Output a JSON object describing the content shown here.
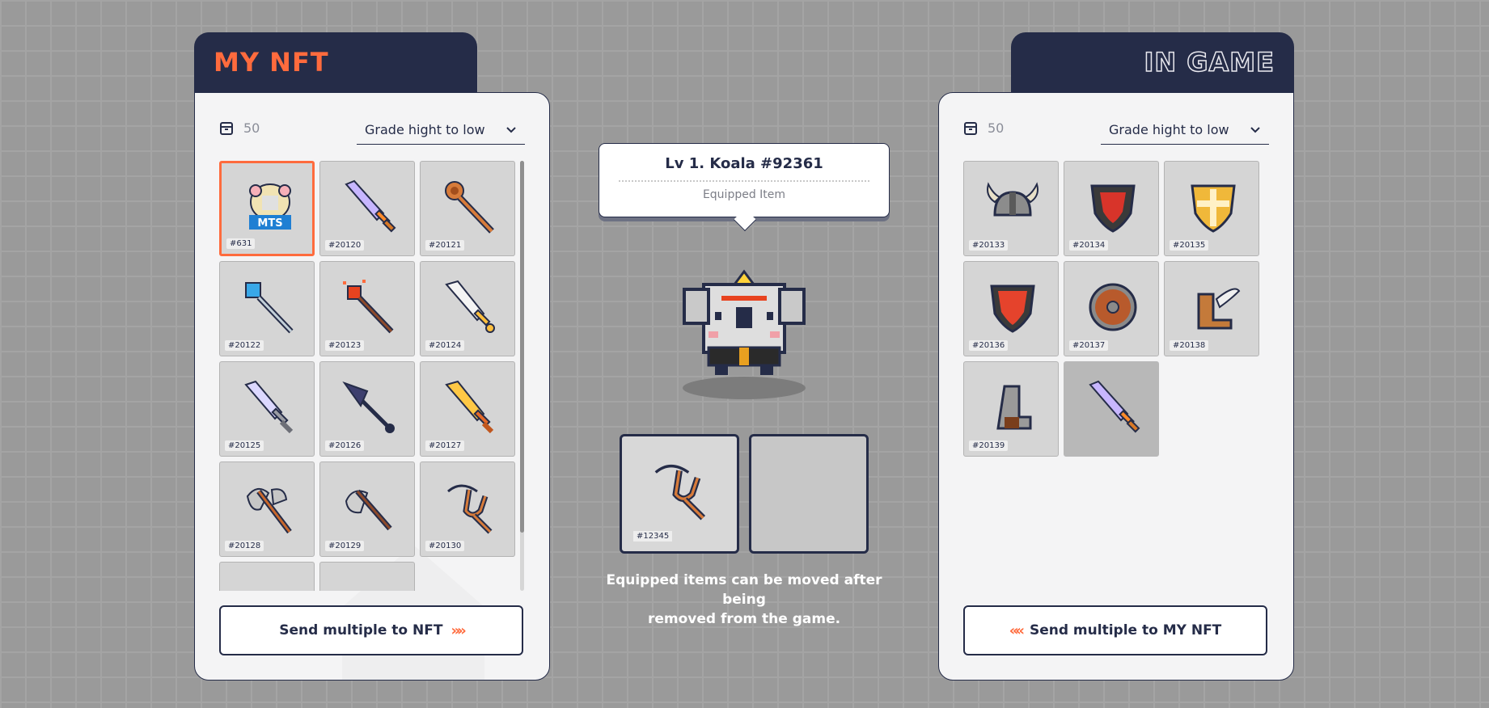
{
  "my_nft": {
    "title": "MY NFT",
    "count": "50",
    "sort": "Grade hight to low",
    "items": [
      {
        "label": "#631",
        "icon": "koala-mts-badge-icon",
        "selected": true
      },
      {
        "label": "#20120",
        "icon": "purple-sword-icon"
      },
      {
        "label": "#20121",
        "icon": "wooden-staff-icon"
      },
      {
        "label": "#20122",
        "icon": "blue-gem-wand-icon"
      },
      {
        "label": "#20123",
        "icon": "fire-staff-icon"
      },
      {
        "label": "#20124",
        "icon": "white-sword-icon"
      },
      {
        "label": "#20125",
        "icon": "silver-sword-icon"
      },
      {
        "label": "#20126",
        "icon": "dark-spear-icon"
      },
      {
        "label": "#20127",
        "icon": "golden-sword-icon"
      },
      {
        "label": "#20128",
        "icon": "double-axe-icon"
      },
      {
        "label": "#20129",
        "icon": "axe-icon"
      },
      {
        "label": "#20130",
        "icon": "slingshot-icon"
      }
    ],
    "send_label": "Send multiple to NFT",
    "send_arrows": "»»"
  },
  "character": {
    "name": "Lv 1. Koala #92361",
    "subtitle": "Equipped Item",
    "slots": [
      {
        "label": "#12345",
        "icon": "slingshot-icon"
      },
      {
        "label": "",
        "icon": "empty-slot"
      }
    ],
    "notice_line1": "Equipped items can be moved after being",
    "notice_line2": "removed from the game."
  },
  "in_game": {
    "title": "IN GAME",
    "count": "50",
    "sort": "Grade hight to low",
    "items": [
      {
        "label": "#20133",
        "icon": "viking-helmet-icon"
      },
      {
        "label": "#20134",
        "icon": "red-black-shield-icon"
      },
      {
        "label": "#20135",
        "icon": "golden-cross-shield-icon"
      },
      {
        "label": "#20136",
        "icon": "red-shield-icon"
      },
      {
        "label": "#20137",
        "icon": "round-wooden-shield-icon"
      },
      {
        "label": "#20138",
        "icon": "winged-boot-icon"
      },
      {
        "label": "#20139",
        "icon": "iron-boot-icon"
      },
      {
        "label": "",
        "icon": "dragged-purple-sword-icon"
      }
    ],
    "send_label": "Send multiple to MY NFT",
    "send_arrows": "««"
  },
  "colors": {
    "accent": "#ff6b3d",
    "navy": "#252c48",
    "cell": "#d5d5d5"
  }
}
